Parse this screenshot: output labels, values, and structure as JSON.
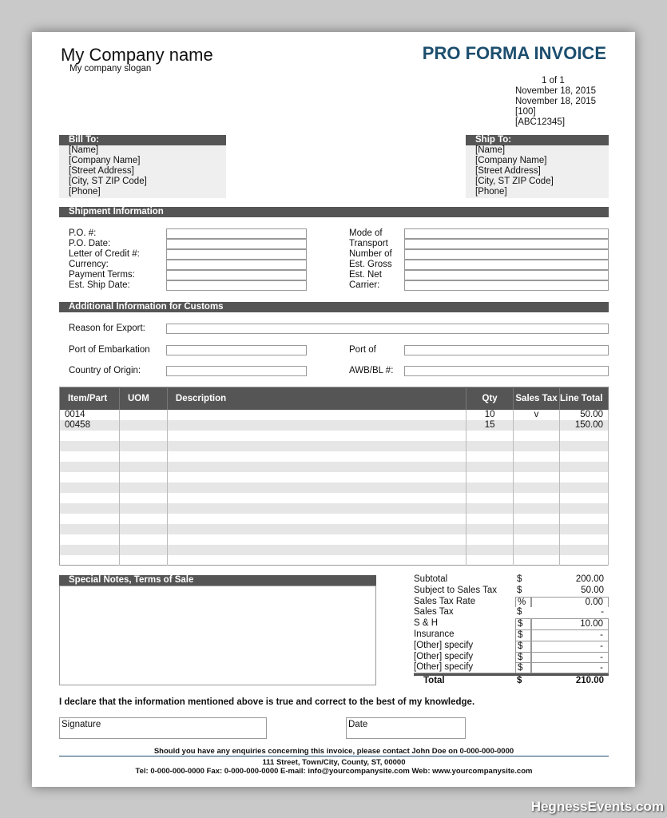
{
  "company": {
    "name": "My Company name",
    "slogan": "My company slogan"
  },
  "title": "PRO FORMA INVOICE",
  "meta": [
    "1 of 1",
    "November 18, 2015",
    "November 18, 2015",
    "[100]",
    "[ABC12345]"
  ],
  "bill_to": {
    "header": "Bill To:",
    "lines": [
      "[Name]",
      "[Company Name]",
      "[Street Address]",
      "[City, ST  ZIP Code]",
      "[Phone]"
    ]
  },
  "ship_to": {
    "header": "Ship To:",
    "lines": [
      "[Name]",
      "[Company Name]",
      "[Street Address]",
      "[City, ST  ZIP Code]",
      "[Phone]"
    ]
  },
  "shipment": {
    "header": "Shipment Information",
    "left": [
      "P.O. #:",
      "P.O. Date:",
      "Letter of Credit #:",
      "Currency:",
      "Payment Terms:",
      "Est. Ship Date:"
    ],
    "right": [
      "Mode of",
      "Transport",
      "Number of",
      "Est. Gross",
      "Est. Net",
      "Carrier:"
    ]
  },
  "customs": {
    "header": "Additional Information for Customs",
    "reason": "Reason for Export:",
    "embark": "Port of Embarkation",
    "port": "Port of",
    "origin": "Country of Origin:",
    "awb": "AWB/BL #:"
  },
  "items": {
    "headers": [
      "Item/Part",
      "UOM",
      "Description",
      "Qty",
      "Sales Tax",
      "Line Total"
    ],
    "rows": [
      [
        "0014",
        "",
        "",
        "10",
        "v",
        "50.00"
      ],
      [
        "00458",
        "",
        "",
        "15",
        "",
        "150.00"
      ]
    ]
  },
  "notes_header": "Special Notes, Terms of Sale",
  "totals": [
    [
      "Subtotal",
      "$",
      "200.00"
    ],
    [
      "Subject to Sales Tax",
      "$",
      "50.00"
    ],
    [
      "Sales Tax Rate",
      "%",
      "0.00"
    ],
    [
      "Sales Tax",
      "$",
      "-"
    ],
    [
      "S & H",
      "$",
      "10.00"
    ],
    [
      "Insurance",
      "$",
      "-"
    ],
    [
      "[Other] specify",
      "$",
      "-"
    ],
    [
      "[Other] specify",
      "$",
      "-"
    ],
    [
      "[Other] specify",
      "$",
      "-"
    ],
    [
      "Total",
      "$",
      "210.00"
    ]
  ],
  "declaration": "I declare that the information mentioned above is true and correct to the best of my knowledge.",
  "signature": "Signature",
  "date": "Date",
  "footer": [
    "Should you have any enquiries concerning this invoice, please contact John Doe on 0-000-000-0000",
    "111 Street, Town/City, County, ST, 00000",
    "Tel: 0-000-000-0000 Fax: 0-000-000-0000 E-mail: info@yourcompanysite.com Web: www.yourcompanysite.com"
  ],
  "watermark": "HegnessEvents.com",
  "colors": {
    "title": "#1d4e6e",
    "bar": "#555555"
  }
}
